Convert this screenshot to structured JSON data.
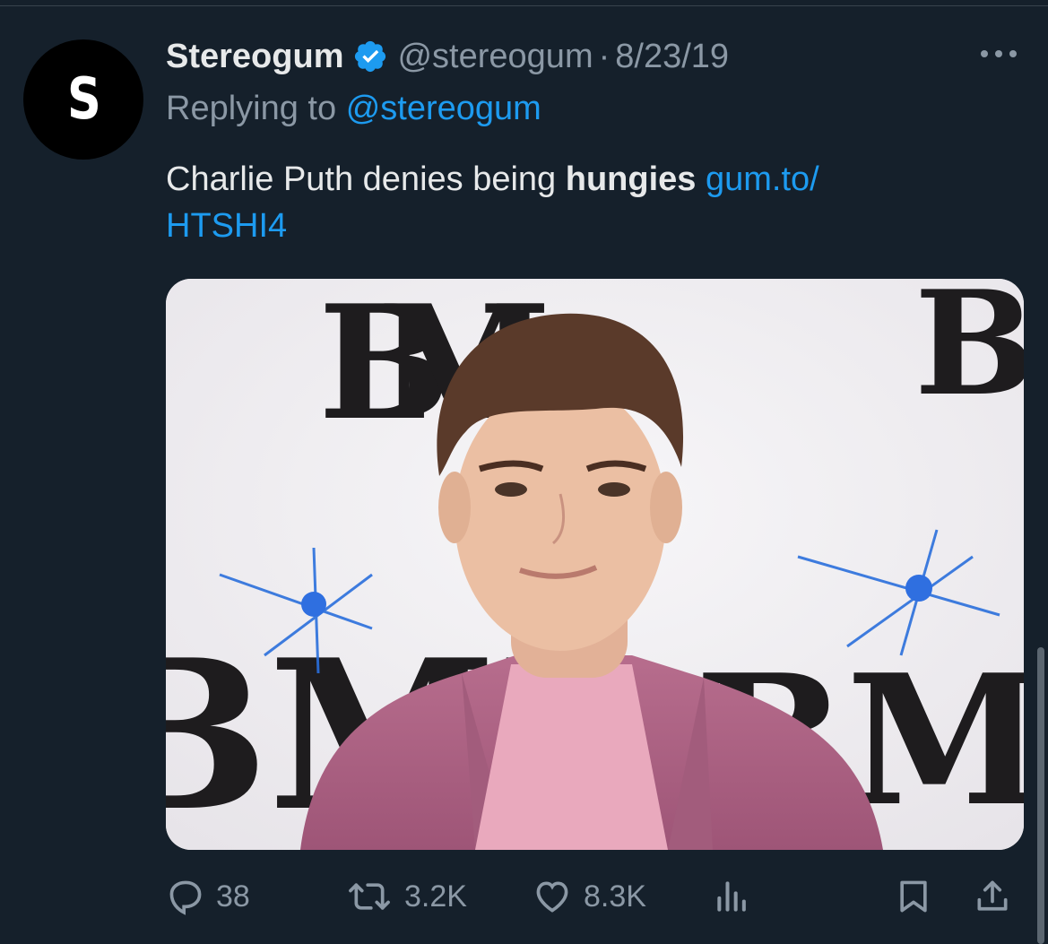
{
  "tweet": {
    "author": {
      "display_name": "Stereogum",
      "handle": "@stereogum",
      "avatar_letter": "S",
      "verified": true
    },
    "separator": "·",
    "date": "8/23/19",
    "replying_prefix": "Replying to",
    "replying_to": "@stereogum",
    "text_before": "Charlie Puth denies being ",
    "text_bold": "hungies",
    "link_line1": "gum.to/",
    "link_line2": "HTSHI4",
    "media": {
      "backdrop_text_left": "BMI",
      "backdrop_text_right": "BMI"
    },
    "actions": {
      "replies": "38",
      "retweets": "3.2K",
      "likes": "8.3K"
    }
  },
  "colors": {
    "background": "#15202b",
    "text_primary": "#e7e9ea",
    "text_secondary": "#8b98a5",
    "accent": "#1d9bf0"
  },
  "icons": [
    "more-icon",
    "verified-icon",
    "reply-icon",
    "retweet-icon",
    "like-icon",
    "views-icon",
    "bookmark-icon",
    "share-icon"
  ]
}
